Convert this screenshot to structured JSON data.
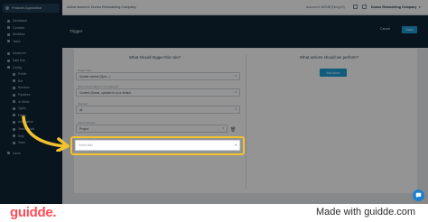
{
  "sidebar": {
    "user_name": "Prashant Agarwalkar",
    "items": [
      {
        "label": "Dashboard",
        "sub": false
      },
      {
        "label": "Contacts",
        "sub": false
      },
      {
        "label": "Workflow",
        "sub": false
      },
      {
        "label": "Tasks",
        "sub": false
      },
      {
        "label": "Advanced",
        "sub": false
      },
      {
        "label": "Data Hub",
        "sub": false
      },
      {
        "label": "Config",
        "sub": false
      },
      {
        "label": "Profile",
        "sub": true
      },
      {
        "label": "Bot",
        "sub": true
      },
      {
        "label": "Services",
        "sub": true
      },
      {
        "label": "Pipelines",
        "sub": true
      },
      {
        "label": "AI Writer",
        "sub": true
      },
      {
        "label": "Types",
        "sub": true
      },
      {
        "label": "Fields",
        "sub": true
      },
      {
        "label": "Automation",
        "sub": true
      },
      {
        "label": "Testimonials",
        "sub": true
      },
      {
        "label": "Help",
        "sub": true
      },
      {
        "label": "Team",
        "sub": true
      },
      {
        "label": "Users",
        "sub": false
      }
    ]
  },
  "topbar": {
    "active_account": "Active account: Dunno Remodeling Company",
    "account_id": "Account id: 669155 (Hiring ID)",
    "company": "Dunno Remodeling Company"
  },
  "header": {
    "title": "Trigger",
    "cancel_label": "Cancel",
    "save_label": "Save"
  },
  "left_panel": {
    "title": "What should trigger this rule?",
    "fields": [
      {
        "label": "Trigger Type",
        "value": "Update context (Spec...)"
      },
      {
        "label": "What should happen to be updated?",
        "value": "Content (Status, updated to a) or default"
      },
      {
        "label": "Operator",
        "value": "all"
      },
      {
        "label": "Select field type",
        "value": "Project"
      }
    ],
    "filter_placeholder": "Select filter"
  },
  "right_panel": {
    "title": "What actions should we perform?",
    "add_action_label": "Add Action"
  },
  "footer": {
    "brand": "guidde.",
    "made_with": "Made with guidde.com"
  },
  "colors": {
    "sidebar_bg": "#0e2535",
    "accent": "#1c9fd8",
    "highlight": "#f2c12e",
    "brand": "#ff4d57"
  },
  "icons": [
    "user-icon",
    "chevron-down-icon",
    "trash-icon",
    "curved-arrow-icon",
    "chat-icon"
  ]
}
